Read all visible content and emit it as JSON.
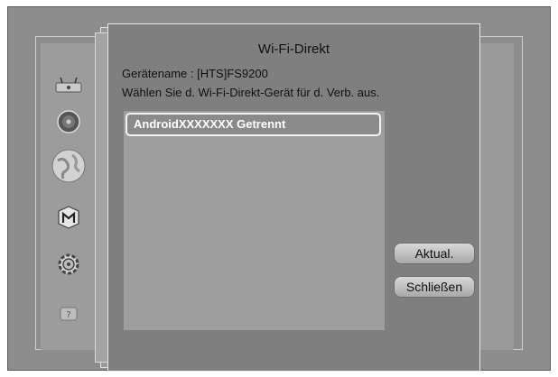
{
  "dialog": {
    "title": "Wi-Fi-Direkt",
    "device_name_line": "Gerätename : [HTS]FS9200",
    "instruction": "Wählen Sie d. Wi-Fi-Direkt-Gerät für d. Verb. aus.",
    "devices": [
      {
        "label": "AndroidXXXXXXX Getrennt"
      }
    ],
    "buttons": {
      "refresh": "Aktual.",
      "close": "Schließen"
    }
  },
  "sidebar": {
    "icons": [
      "wifi-router-icon",
      "disc-icon",
      "globe-icon",
      "smart-hub-icon",
      "settings-gear-icon",
      "help-icon"
    ]
  }
}
